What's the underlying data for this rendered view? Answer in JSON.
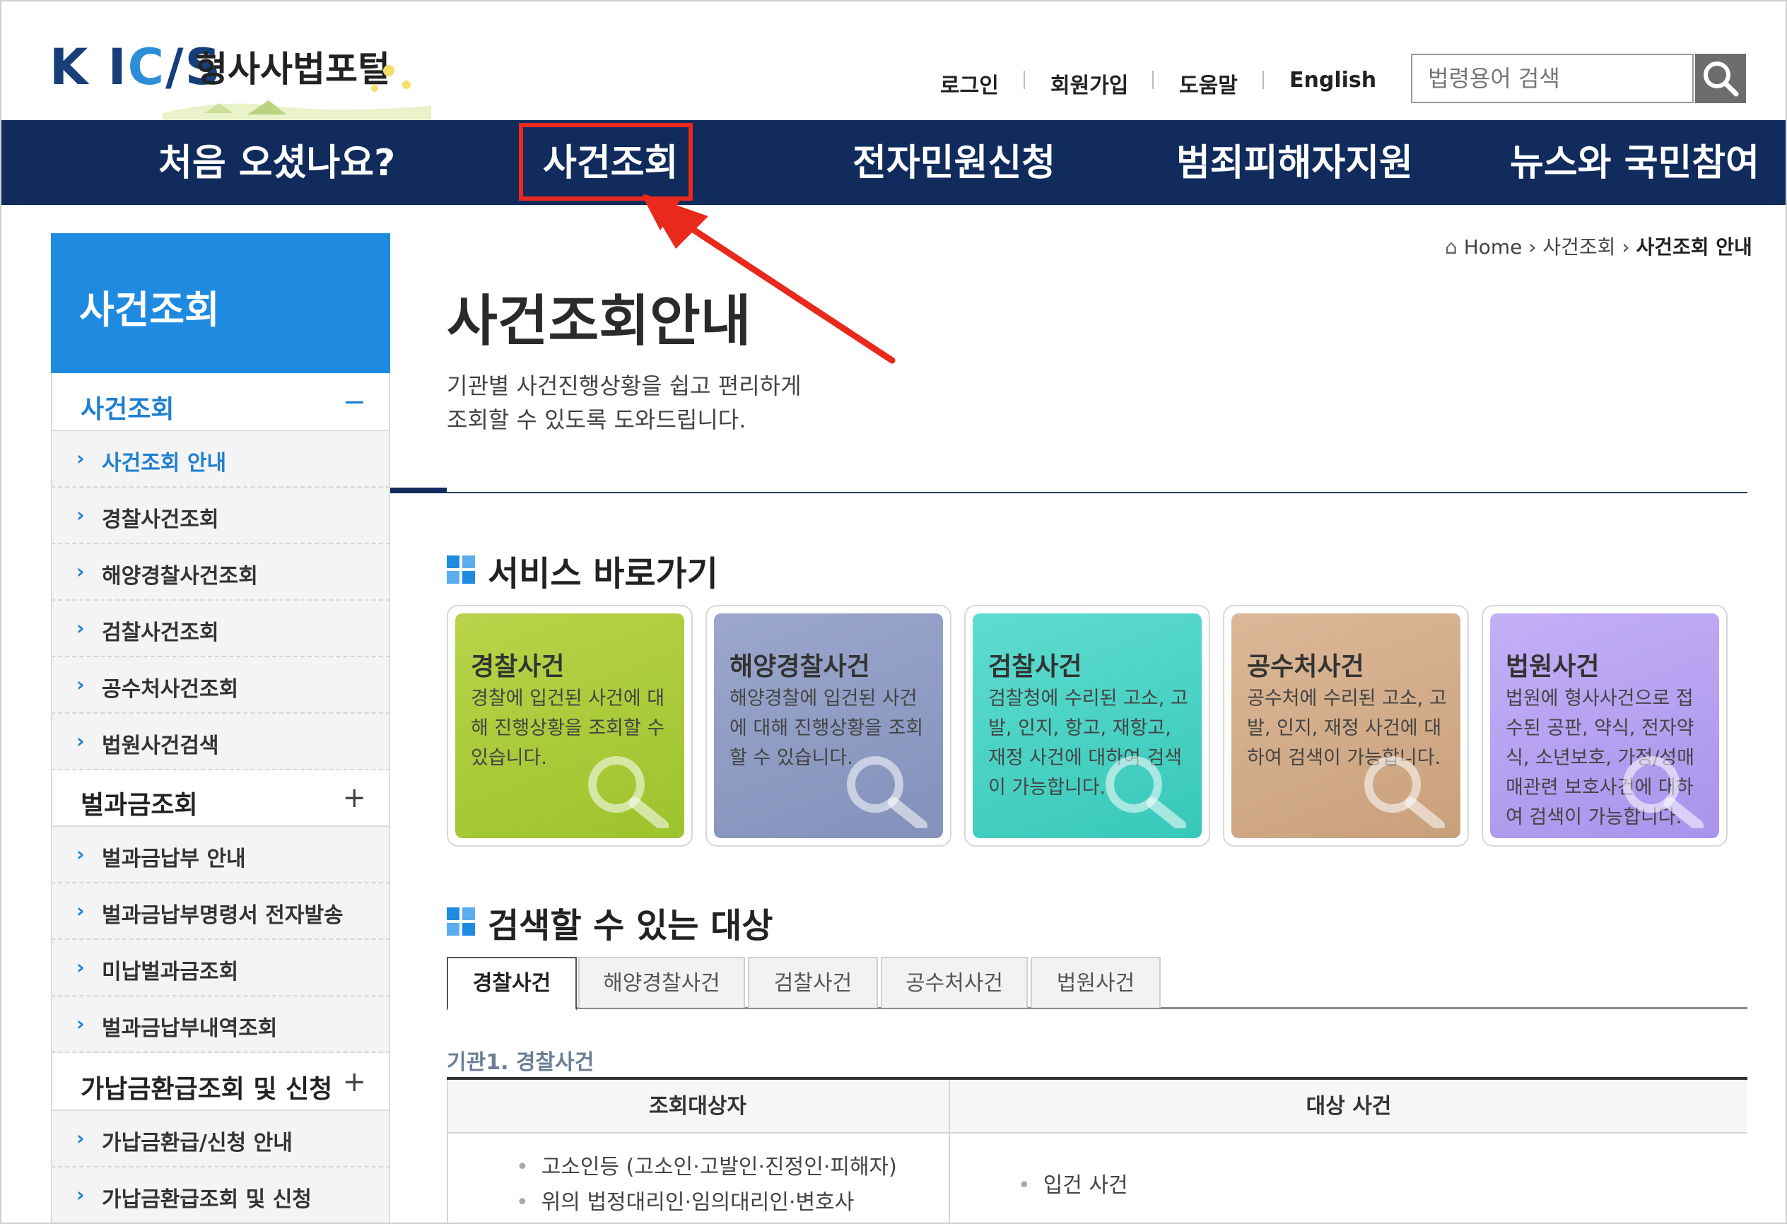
{
  "header": {
    "logo_text": "KICS",
    "site_title": "형사사법포털",
    "links": [
      "로그인",
      "회원가입",
      "도움말",
      "English"
    ],
    "search_placeholder": "법령용어 검색"
  },
  "nav": {
    "items": [
      "처음 오셨나요?",
      "사건조회",
      "전자민원신청",
      "범죄피해자지원",
      "뉴스와 국민참여"
    ],
    "highlighted": "사건조회",
    "highlight_color": "#e8291c"
  },
  "sidebar": {
    "title": "사건조회",
    "groups": [
      {
        "label": "사건조회",
        "toggle": "−",
        "items": [
          "사건조회 안내",
          "경찰사건조회",
          "해양경찰사건조회",
          "검찰사건조회",
          "공수처사건조회",
          "법원사건검색"
        ]
      },
      {
        "label": "벌과금조회",
        "toggle": "+",
        "items": [
          "벌과금납부 안내",
          "벌과금납부명령서 전자발송",
          "미납벌과금조회",
          "벌과금납부내역조회"
        ]
      },
      {
        "label": "가납금환급조회 및 신청",
        "toggle": "+",
        "items": [
          "가납금환급/신청 안내",
          "가납금환급조회 및 신청"
        ]
      }
    ]
  },
  "breadcrumb": {
    "home": "Home",
    "level1": "사건조회",
    "current": "사건조회 안내"
  },
  "page": {
    "title": "사건조회안내",
    "desc_line1": "기관별 사건진행상황을 쉽고 편리하게",
    "desc_line2": "조회할 수 있도록 도와드립니다."
  },
  "services": {
    "title": "서비스 바로가기",
    "cards": [
      {
        "title": "경찰사건",
        "desc": "경찰에 입건된 사건에 대해 진행상황을 조회할 수 있습니다.",
        "color": "#a8c83a"
      },
      {
        "title": "해양경찰사건",
        "desc": "해양경찰에 입건된 사건에 대해 진행상황을 조회할 수 있습니다.",
        "color": "#8f9cc3"
      },
      {
        "title": "검찰사건",
        "desc": "검찰청에 수리된 고소, 고발, 인지, 항고, 재항고, 재정 사건에 대하여 검색이 가능합니다.",
        "color": "#4fd3c6"
      },
      {
        "title": "공수처사건",
        "desc": "공수처에 수리된 고소, 고발, 인지, 재정 사건에 대하여 검색이 가능합니다.",
        "color": "#d6b08f"
      },
      {
        "title": "법원사건",
        "desc": "법원에 형사사건으로 접수된 공판, 약식, 전자약식, 소년보호, 가정/성매매관련 보호사건에 대하여 검색이 가능합니다.",
        "color": "#b8a4f2"
      }
    ]
  },
  "targets": {
    "title": "검색할 수 있는 대상",
    "tabs": [
      "경찰사건",
      "해양경찰사건",
      "검찰사건",
      "공수처사건",
      "법원사건"
    ],
    "active_tab": "경찰사건",
    "subtitle": "기관1. 경찰사건",
    "table": {
      "headers": [
        "조회대상자",
        "대상 사건"
      ],
      "left_items": [
        "고소인등 (고소인·고발인·진정인·피해자)",
        "위의 법정대리인·임의대리인·변호사"
      ],
      "right_items": [
        "입건 사건"
      ]
    }
  }
}
